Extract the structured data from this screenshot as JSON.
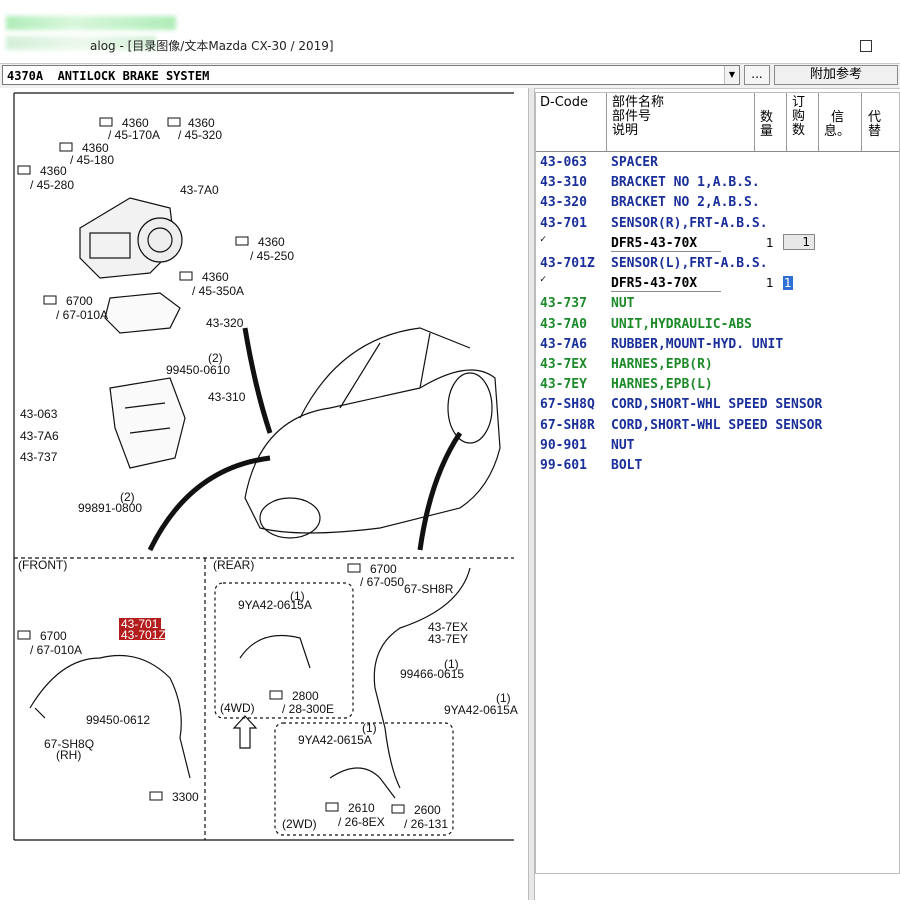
{
  "window": {
    "title": "alog - [目录图像/文本Mazda CX-30 / 2019]"
  },
  "toolbar": {
    "section": "4370A  ANTILOCK BRAKE SYSTEM",
    "dots_label": "...",
    "ref_button": "附加参考"
  },
  "table": {
    "headers": {
      "dcode": "D-Code",
      "name1": "部件名称",
      "name2": "部件号",
      "name3": "说明",
      "qty1": "数",
      "qty2": "量",
      "order1": "订",
      "order2": "购",
      "order3": "数",
      "info1": "信",
      "info2": "息。",
      "alt1": "代",
      "alt2": "替"
    },
    "rows": [
      {
        "code": "43-063",
        "name": "SPACER",
        "color": "#1a2f9a"
      },
      {
        "code": "43-310",
        "name": "BRACKET NO 1,A.B.S.",
        "color": "#1a2f9a"
      },
      {
        "code": "43-320",
        "name": "BRACKET NO 2,A.B.S.",
        "color": "#1a2f9a"
      },
      {
        "code": "43-701",
        "name": "SENSOR(R),FRT-A.B.S.",
        "color": "#1a2f9a"
      },
      {
        "code": "43-701Z",
        "name": "SENSOR(L),FRT-A.B.S.",
        "color": "#1a2f9a"
      },
      {
        "code": "43-737",
        "name": "NUT",
        "color": "#1d8a2a"
      },
      {
        "code": "43-7A0",
        "name": "UNIT,HYDRAULIC-ABS",
        "color": "#1d8a2a"
      },
      {
        "code": "43-7A6",
        "name": "RUBBER,MOUNT-HYD. UNIT",
        "color": "#1a2f9a"
      },
      {
        "code": "43-7EX",
        "name": "HARNES,EPB(R)",
        "color": "#1d8a2a"
      },
      {
        "code": "43-7EY",
        "name": "HARNES,EPB(L)",
        "color": "#1d8a2a"
      },
      {
        "code": "67-SH8Q",
        "name": "CORD,SHORT-WHL SPEED SENSOR",
        "color": "#1a2f9a"
      },
      {
        "code": "67-SH8R",
        "name": "CORD,SHORT-WHL SPEED SENSOR",
        "color": "#1a2f9a"
      },
      {
        "code": "90-901",
        "name": "NUT",
        "color": "#1a2f9a"
      },
      {
        "code": "99-601",
        "name": "BOLT",
        "color": "#1a2f9a"
      }
    ],
    "subrows": [
      {
        "part_no": "DFR5-43-70X",
        "qty": "1",
        "order": "1"
      },
      {
        "part_no": "DFR5-43-70X",
        "qty": "1",
        "order": "1"
      }
    ],
    "check_mark": "✓"
  },
  "diagram": {
    "labels": {
      "front": "(FRONT)",
      "rear": "(REAR)",
      "fourwd": "(4WD)",
      "twowd": "(2WD)",
      "l4360a": "4360",
      "l45170a": "/ 45-170A",
      "l4360b": "4360",
      "l45320": "/ 45-320",
      "l4360c": "4360",
      "l45180": "/ 45-180",
      "l4360d": "4360",
      "l45280": "/ 45-280",
      "l437a0": "43-7A0",
      "l4360e": "4360",
      "l45250": "/ 45-250",
      "l4360f": "4360",
      "l45350a": "/ 45-350A",
      "l6700a": "6700",
      "l67010a": "/ 67-010A",
      "l43320": "43-320",
      "l2a": "(2)",
      "l99450a": "99450-0610",
      "l43310": "43-310",
      "l43063": "43-063",
      "l437a6": "43-7A6",
      "l43737": "43-737",
      "l2b": "(2)",
      "l99891": "99891-0800",
      "l6700b": "6700",
      "l67010b": "/ 67-010A",
      "l43701": "43-701",
      "l43701z": "43-701Z",
      "l99450b": "99450-0612",
      "l67sh8q": "67-SH8Q",
      "lrh": "(RH)",
      "l3300": "3300",
      "l9ya42a": "9YA42-0615A",
      "l1a": "(1)",
      "l2800": "2800",
      "l28300e": "/ 28-300E",
      "l6700c": "6700",
      "l67050": "/ 67-050",
      "l67sh8r": "67-SH8R",
      "l437ex": "43-7EX",
      "l437ey": "43-7EY",
      "l1b": "(1)",
      "l99466": "99466-0615",
      "l1c": "(1)",
      "l9ya42b": "9YA42-0615A",
      "l1d": "(1)",
      "l9ya42c": "9YA42-0615A",
      "l2610": "2610",
      "l268ex": "/ 26-8EX",
      "l2600": "2600",
      "l26131": "/ 26-131"
    }
  }
}
